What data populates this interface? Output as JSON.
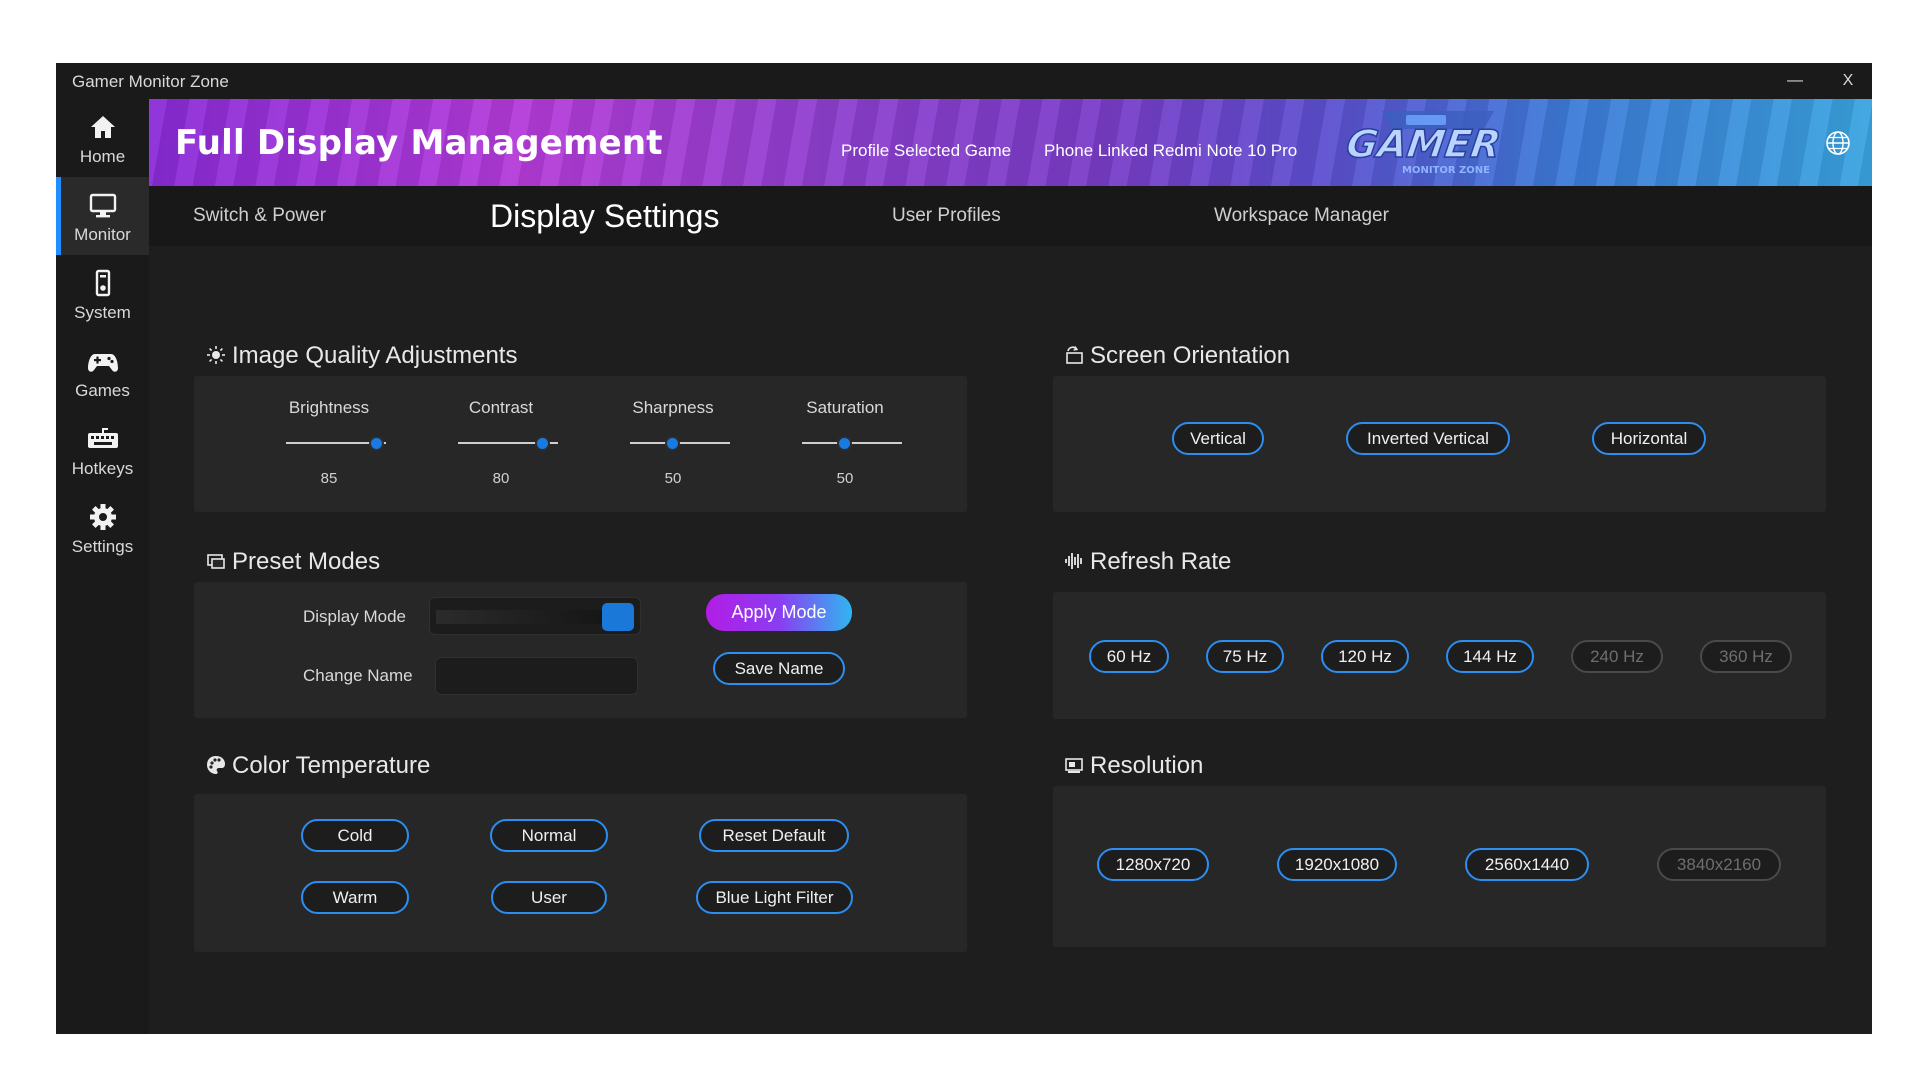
{
  "window": {
    "title": "Gamer Monitor Zone",
    "minimize_label": "—",
    "close_label": "X"
  },
  "sidebar": {
    "items": [
      {
        "label": "Home",
        "icon": "home-icon"
      },
      {
        "label": "Monitor",
        "icon": "monitor-icon",
        "active": true
      },
      {
        "label": "System",
        "icon": "system-icon"
      },
      {
        "label": "Games",
        "icon": "gamepad-icon"
      },
      {
        "label": "Hotkeys",
        "icon": "keyboard-icon"
      },
      {
        "label": "Settings",
        "icon": "gear-icon"
      }
    ]
  },
  "banner": {
    "title": "Full Display Management",
    "profile_text": "Profile Selected Game",
    "phone_text": "Phone Linked Redmi Note 10 Pro",
    "logo_text": "GAMER",
    "logo_subtext": "MONITOR ZONE",
    "globe_icon": "globe-icon"
  },
  "tabs": [
    {
      "label": "Switch & Power"
    },
    {
      "label": "Display Settings",
      "active": true
    },
    {
      "label": "User Profiles"
    },
    {
      "label": "Workspace Manager"
    }
  ],
  "image_quality": {
    "title": "Image Quality Adjustments",
    "icon": "sun-icon",
    "sliders": [
      {
        "label": "Brightness",
        "value": 85
      },
      {
        "label": "Contrast",
        "value": 80
      },
      {
        "label": "Sharpness",
        "value": 50
      },
      {
        "label": "Saturation",
        "value": 50
      }
    ]
  },
  "preset_modes": {
    "title": "Preset Modes",
    "icon": "display-mode-icon",
    "display_mode_label": "Display Mode",
    "change_name_label": "Change Name",
    "change_name_value": "",
    "apply_label": "Apply Mode",
    "save_label": "Save Name"
  },
  "color_temperature": {
    "title": "Color Temperature",
    "icon": "palette-icon",
    "buttons": [
      "Cold",
      "Normal",
      "Reset Default",
      "Warm",
      "User",
      "Blue Light Filter"
    ]
  },
  "screen_orientation": {
    "title": "Screen Orientation",
    "icon": "rotate-icon",
    "options": [
      "Vertical",
      "Inverted Vertical",
      "Horizontal"
    ]
  },
  "refresh_rate": {
    "title": "Refresh Rate",
    "icon": "waveform-icon",
    "options": [
      {
        "label": "60 Hz",
        "enabled": true
      },
      {
        "label": "75 Hz",
        "enabled": true
      },
      {
        "label": "120 Hz",
        "enabled": true
      },
      {
        "label": "144 Hz",
        "enabled": true
      },
      {
        "label": "240 Hz",
        "enabled": false
      },
      {
        "label": "360 Hz",
        "enabled": false
      }
    ]
  },
  "resolution": {
    "title": "Resolution",
    "icon": "resolution-icon",
    "options": [
      {
        "label": "1280x720",
        "enabled": true
      },
      {
        "label": "1920x1080",
        "enabled": true
      },
      {
        "label": "2560x1440",
        "enabled": true
      },
      {
        "label": "3840x2160",
        "enabled": false
      }
    ]
  },
  "colors": {
    "accent": "#2b8ef0",
    "slider_thumb": "#1a7ae0",
    "panel": "#272727",
    "background": "#1e1e1e"
  }
}
